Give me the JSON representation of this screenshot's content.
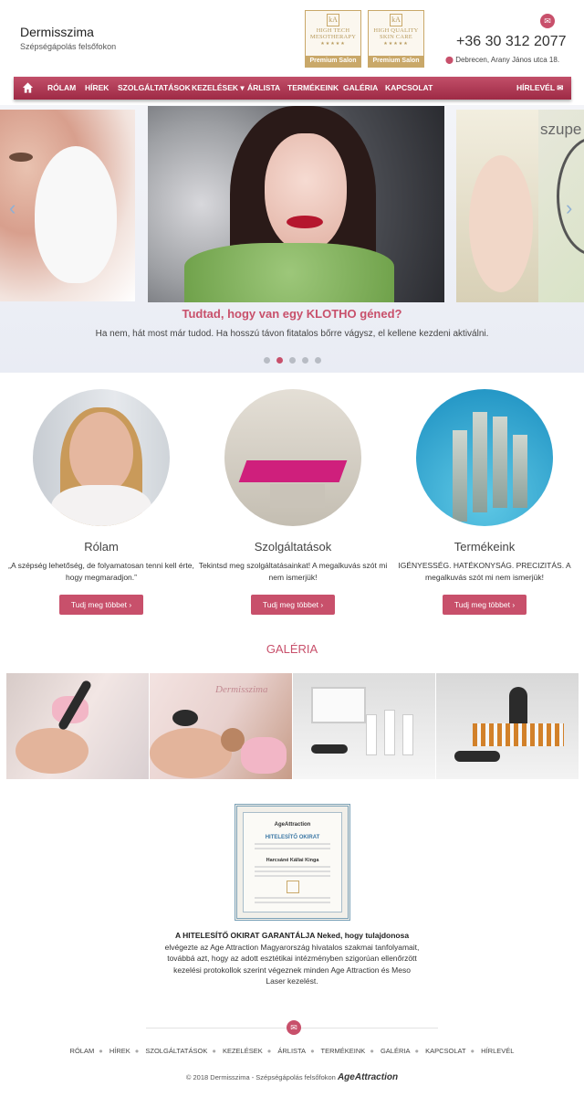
{
  "header": {
    "brand": "Dermisszima",
    "tagline": "Szépségápolás felsőfokon",
    "badges": [
      {
        "logo": "kA",
        "line1": "HIGH TECH",
        "line2": "MESOTHERAPY",
        "stars": "★★★★★",
        "label": "Premium Salon"
      },
      {
        "logo": "kA",
        "line1": "HIGH QUALITY",
        "line2": "SKIN CARE",
        "stars": "★★★★★",
        "label": "Premium Salon"
      }
    ],
    "phone": "+36 30 312 2077",
    "address": "Debrecen, Arany János utca 18."
  },
  "nav": {
    "items": [
      "RÓLAM",
      "HÍREK",
      "SZOLGÁLTATÁSOK",
      "KEZELÉSEK ▾",
      "ÁRLISTA",
      "TERMÉKEINK",
      "GALÉRIA",
      "KAPCSOLAT"
    ],
    "newsletter": "HÍRLEVÉL"
  },
  "slider": {
    "overlay_word": "szupe",
    "title": "Tudtad, hogy van egy KLOTHO géned?",
    "subtitle": "Ha nem, hát most már tudod. Ha hosszú távon fitatalos bőrre vágysz, el kellene kezdeni aktiválni.",
    "active_slide": 2,
    "slide_count": 5,
    "prev": "‹",
    "next": "›"
  },
  "features": [
    {
      "title": "Rólam",
      "text": "„A szépség lehetőség, de folyamatosan tenni kell érte, hogy megmaradjon.”",
      "button": "Tudj meg többet ›"
    },
    {
      "title": "Szolgáltatások",
      "text": "Tekintsd meg szolgáltatásainkat! A megalkuvás szót mi nem ismerjük!",
      "button": "Tudj meg többet ›"
    },
    {
      "title": "Termékeink",
      "text": "IGÉNYESSÉG. HATÉKONYSÁG. PRECIZITÁS. A megalkuvás szót mi nem ismerjük!",
      "button": "Tudj meg többet ›"
    }
  ],
  "gallery": {
    "title": "GALÉRIA",
    "watermark": "Dermisszima"
  },
  "certificate": {
    "brand": "AgeAttraction",
    "heading": "HITELESÍTŐ OKIRAT",
    "name": "Harcsáné Kállai Kinga",
    "lead": "A HITELESÍTŐ OKIRAT GARANTÁLJA Neked, hogy tulajdonosa",
    "body": "elvégezte az Age Attraction Magyarország hivatalos szakmai tanfolyamait, továbbá azt, hogy az adott esztétikai intézményben szigorúan ellenőrzött kezelési protokollok szerint végeznek minden Age Attraction és Meso Laser kezelést."
  },
  "footer": {
    "links": [
      "RÓLAM",
      "HÍREK",
      "SZOLGÁLTATÁSOK",
      "KEZELÉSEK",
      "ÁRLISTA",
      "TERMÉKEINK",
      "GALÉRIA",
      "KAPCSOLAT",
      "HÍRLEVÉL"
    ],
    "copyright": "© 2018 Dermisszima - Szépségápolás felsőfokon",
    "partner": "AgeAttraction"
  },
  "colors": {
    "accent": "#c8506b",
    "nav_dark": "#9e2a45"
  }
}
